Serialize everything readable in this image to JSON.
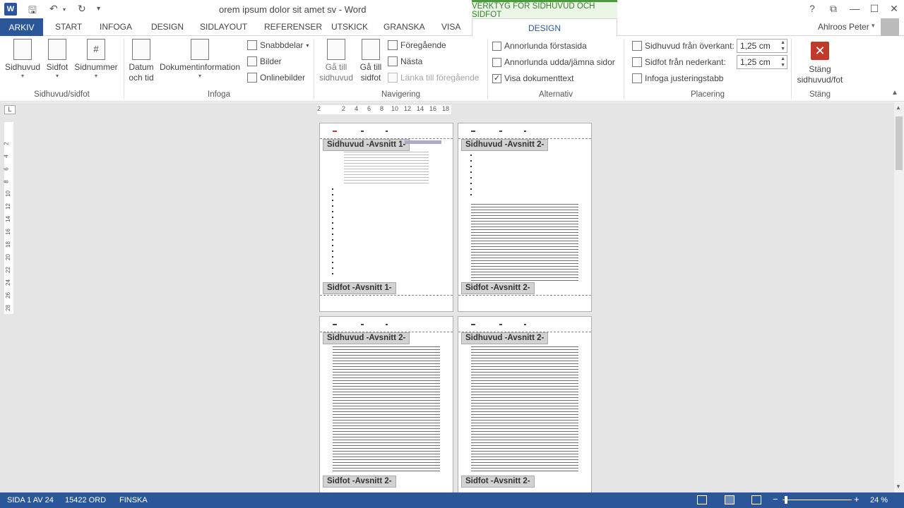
{
  "titlebar": {
    "title": "orem ipsum dolor sit amet sv - Word",
    "context_group": "VERKTYG FÖR SIDHUVUD OCH SIDFOT",
    "help": "?",
    "restore": "⧉",
    "minimize": "—",
    "maximize": "☐",
    "close": "✕"
  },
  "tabs": {
    "file": "ARKIV",
    "items": [
      "START",
      "INFOGA",
      "DESIGN",
      "SIDLAYOUT",
      "REFERENSER",
      "UTSKICK",
      "GRANSKA",
      "VISA"
    ],
    "active": "DESIGN",
    "user": "Ahlroos Peter"
  },
  "ribbon": {
    "group1": {
      "label": "Sidhuvud/sidfot",
      "sidhuvud": "Sidhuvud",
      "sidfot": "Sidfot",
      "sidnummer": "Sidnummer"
    },
    "group2": {
      "label": "Infoga",
      "datum_l1": "Datum",
      "datum_l2": "och tid",
      "dokinfo": "Dokumentinformation",
      "snabbdelar": "Snabbdelar",
      "bilder": "Bilder",
      "onlinebilder": "Onlinebilder"
    },
    "group3": {
      "label": "Navigering",
      "gatill1_l1": "Gå till",
      "gatill1_l2": "sidhuvud",
      "gatill2_l1": "Gå till",
      "gatill2_l2": "sidfot",
      "foregaende": "Föregående",
      "nasta": "Nästa",
      "lanka": "Länka till föregående"
    },
    "group4": {
      "label": "Alternativ",
      "opt1": "Annorlunda förstasida",
      "opt2": "Annorlunda udda/jämna sidor",
      "opt3": "Visa dokumenttext",
      "opt3_checked": "✓"
    },
    "group5": {
      "label": "Placering",
      "header_from_top": "Sidhuvud från överkant:",
      "header_value": "1,25 cm",
      "footer_from_bottom": "Sidfot från nederkant:",
      "footer_value": "1,25 cm",
      "align_tab": "Infoga justeringstabb"
    },
    "group6": {
      "label": "Stäng",
      "close_l1": "Stäng",
      "close_l2": "sidhuvud/fot"
    }
  },
  "ruler": {
    "h_ticks": [
      "2",
      "2",
      "4",
      "6",
      "8",
      "10",
      "12",
      "14",
      "16",
      "18"
    ],
    "v_ticks": [
      "2",
      "4",
      "6",
      "8",
      "10",
      "12",
      "14",
      "16",
      "18",
      "20",
      "22",
      "24",
      "26",
      "28"
    ],
    "tab_selector": "L"
  },
  "pages": {
    "p1_header": "Sidhuvud -Avsnitt 1-",
    "p1_footer": "Sidfot -Avsnitt 1-",
    "p2_header": "Sidhuvud -Avsnitt 2-",
    "p2_footer": "Sidfot -Avsnitt 2-",
    "p3_header": "Sidhuvud -Avsnitt 2-",
    "p3_footer": "Sidfot -Avsnitt 2-",
    "p4_header": "Sidhuvud -Avsnitt 2-",
    "p4_footer": "Sidfot -Avsnitt 2-"
  },
  "status": {
    "page": "SIDA 1 AV 24",
    "words": "15422 ORD",
    "language": "FINSKA",
    "zoom_minus": "−",
    "zoom_plus": "+",
    "zoom": "24 %"
  },
  "colors": {
    "accent": "#2b579a",
    "context_green": "#4a9b3c",
    "close_red": "#c0392b"
  }
}
